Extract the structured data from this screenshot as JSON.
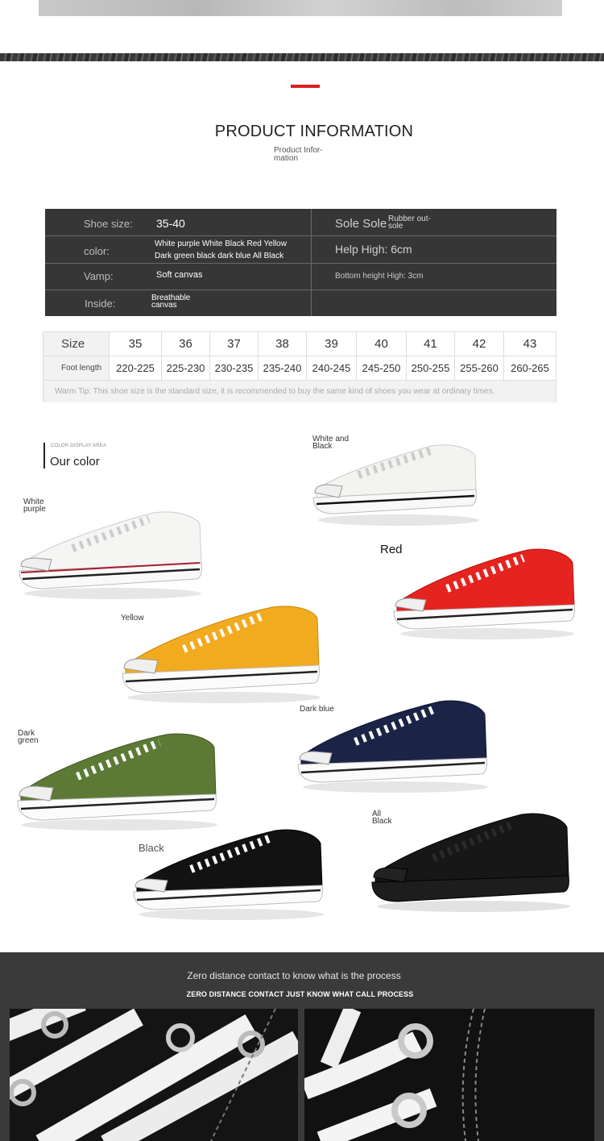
{
  "product_info": {
    "title": "PRODUCT INFORMATION",
    "subtitle": "Product Infor-\nmation"
  },
  "info_table": {
    "shoe_size_label": "Shoe size:",
    "shoe_size_value": "35-40",
    "color_label": "color:",
    "color_value": "White purple White Black Red Yellow\nDark green black dark blue All Black",
    "vamp_label": "Vamp:",
    "vamp_value": "Soft canvas",
    "inside_label": "Inside:",
    "inside_value": "Breathable\ncanvas",
    "sole_label": "Sole Sole",
    "sole_value": "Rubber out-\nsole",
    "help_high": "Help High: 6cm",
    "bottom_height": "Bottom height High: 3cm"
  },
  "size_table": {
    "size_label": "Size",
    "foot_length_label": "Foot length",
    "sizes": [
      "35",
      "36",
      "37",
      "38",
      "39",
      "40",
      "41",
      "42",
      "43"
    ],
    "lengths": [
      "220-225",
      "225-230",
      "230-235",
      "235-240",
      "240-245",
      "245-250",
      "250-255",
      "255-260",
      "260-265"
    ],
    "tip": "Warm Tip: This shoe size is the standard size, it is recommended to buy the same kind of shoes you wear at ordinary times."
  },
  "color_display": {
    "small_label": "COLOR DISPLAY AREA",
    "title": "Our color"
  },
  "shoes": [
    {
      "label": "White and\nBlack",
      "color": "#f3f3f0"
    },
    {
      "label": "White\npurple",
      "color": "#f5f5f3"
    },
    {
      "label": "Red",
      "color": "#e5231f"
    },
    {
      "label": "Yellow",
      "color": "#f2aa1f"
    },
    {
      "label": "Dark blue",
      "color": "#1b2347"
    },
    {
      "label": "Dark\ngreen",
      "color": "#5c7a35"
    },
    {
      "label": "All\nBlack",
      "color": "#171717"
    },
    {
      "label": "Black",
      "color": "#121212"
    }
  ],
  "process": {
    "title": "Zero distance contact to know what is the process",
    "subtitle": "ZERO DISTANCE CONTACT JUST KNOW WHAT CALL PROCESS"
  }
}
